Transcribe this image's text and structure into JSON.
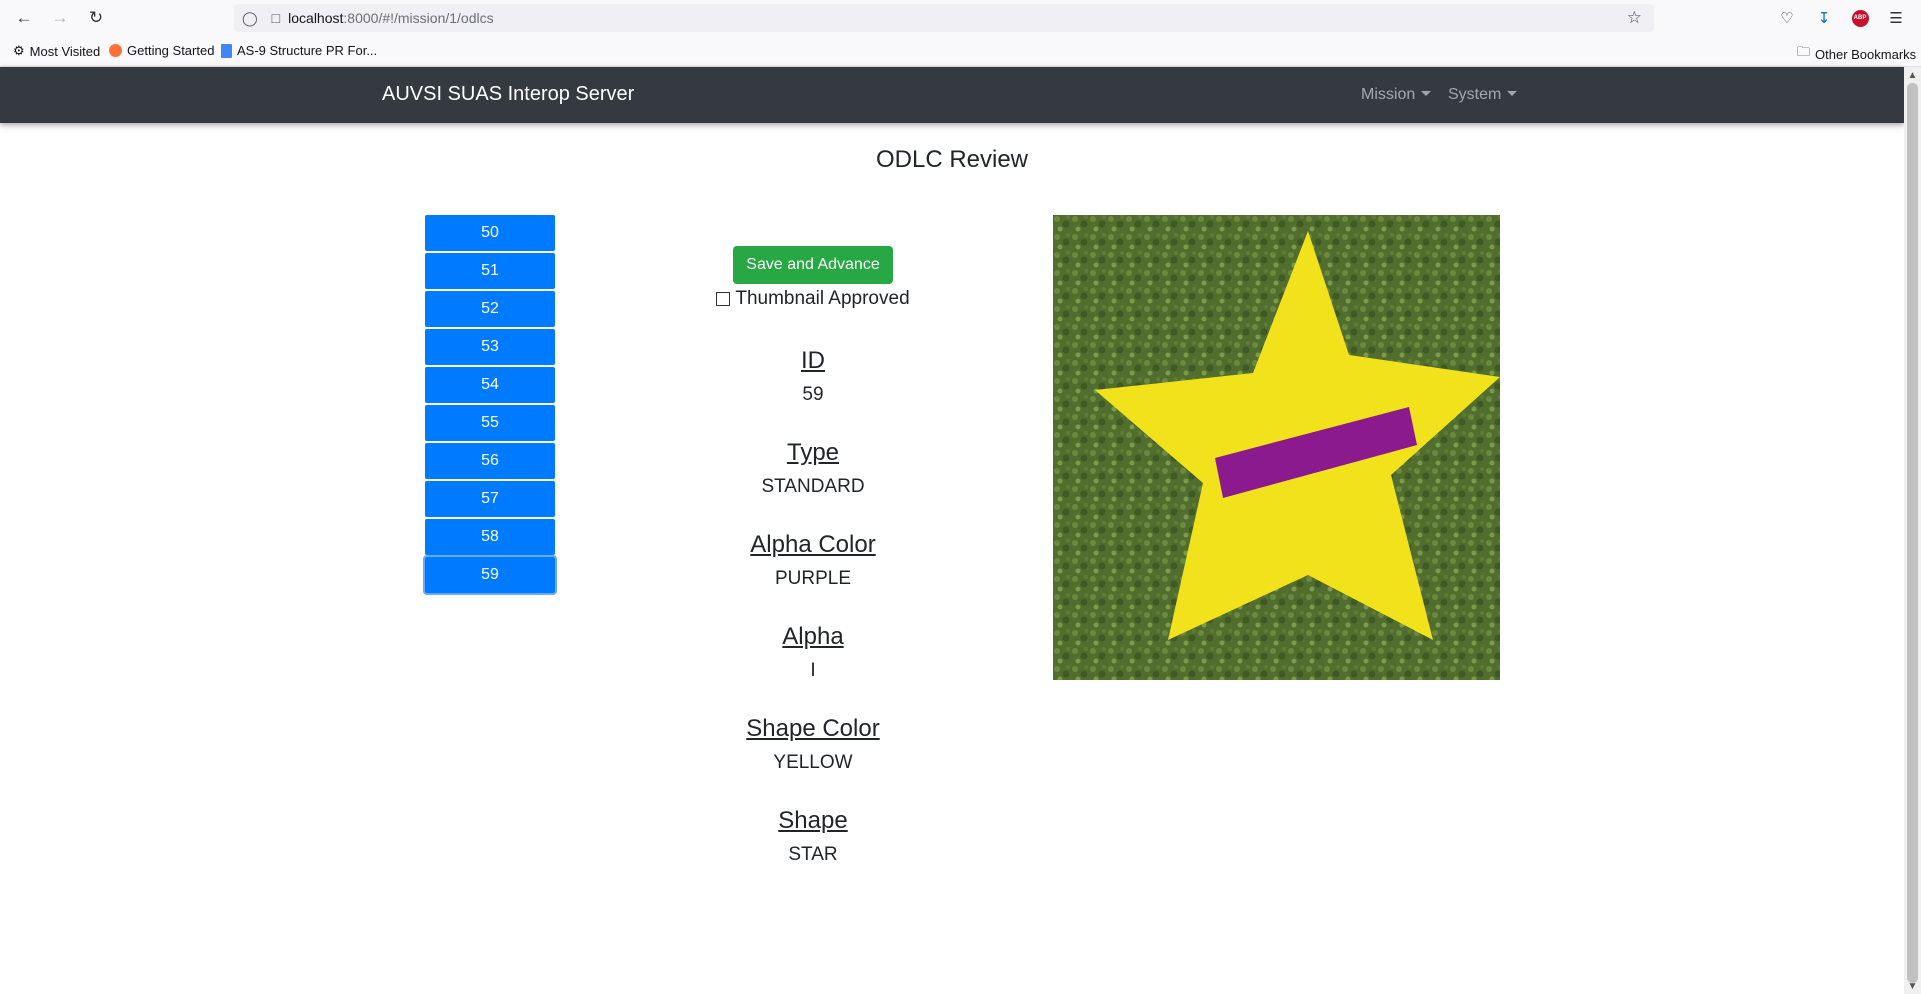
{
  "browser": {
    "url_host": "localhost",
    "url_path": ":8000/#!/mission/1/odlcs",
    "bookmarks": [
      "Most Visited",
      "Getting Started",
      "AS-9 Structure PR For..."
    ],
    "other_bookmarks": "Other Bookmarks",
    "extension_label": "ABP"
  },
  "navbar": {
    "brand": "AUVSI SUAS Interop Server",
    "menus": [
      "Mission",
      "System"
    ]
  },
  "page": {
    "title": "ODLC Review"
  },
  "odlc_list": {
    "ids": [
      "50",
      "51",
      "52",
      "53",
      "54",
      "55",
      "56",
      "57",
      "58",
      "59"
    ],
    "selected": "59"
  },
  "review": {
    "save_label": "Save and Advance",
    "thumbnail_approved_label": "Thumbnail Approved",
    "thumbnail_approved": false,
    "fields": [
      {
        "label": "ID",
        "value": "59"
      },
      {
        "label": "Type",
        "value": "STANDARD"
      },
      {
        "label": "Alpha Color",
        "value": "PURPLE"
      },
      {
        "label": "Alpha",
        "value": "I"
      },
      {
        "label": "Shape Color",
        "value": "YELLOW"
      },
      {
        "label": "Shape",
        "value": "STAR"
      }
    ]
  },
  "colors": {
    "navbar_bg": "#343a40",
    "list_button": "#007bff",
    "save_button": "#28a745",
    "star": "#f2e21c",
    "letter": "#8b1a8e",
    "grass": "#4e6a2c"
  }
}
